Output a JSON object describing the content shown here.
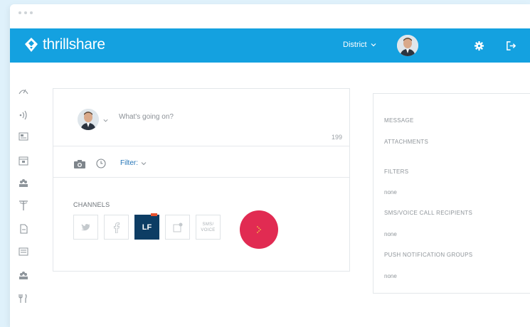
{
  "header": {
    "brand": "thrillshare",
    "district_label": "District"
  },
  "compose": {
    "placeholder": "What's going on?",
    "char_count": "199",
    "filter_label": "Filter:",
    "channels_label": "CHANNELS",
    "channels": [
      "twitter-channel",
      "facebook-channel",
      "LF",
      "push-notification-channel",
      "SMS/ VOICE"
    ],
    "lf_label": "LF",
    "sms_line1": "SMS/",
    "sms_line2": "VOICE"
  },
  "summary": {
    "message_label": "MESSAGE",
    "attachments_label": "ATTACHMENTS",
    "filters_label": "FILTERS",
    "filters_value": "none",
    "sms_label": "SMS/VOICE CALL RECIPIENTS",
    "sms_value": "none",
    "push_label": "PUSH NOTIFICATION GROUPS",
    "push_value": "none"
  },
  "colors": {
    "header": "#14a1e0",
    "send_button": "#e12b52",
    "lf_channel": "#0d3d64",
    "filter_link": "#2475b8"
  },
  "icons": {
    "sidebar": [
      "dashboard-icon",
      "broadcast-icon",
      "news-icon",
      "calendar-icon",
      "groups-icon",
      "antenna-icon",
      "document-icon",
      "newsletter-icon",
      "staff-icon",
      "menu-utensils-icon"
    ]
  }
}
